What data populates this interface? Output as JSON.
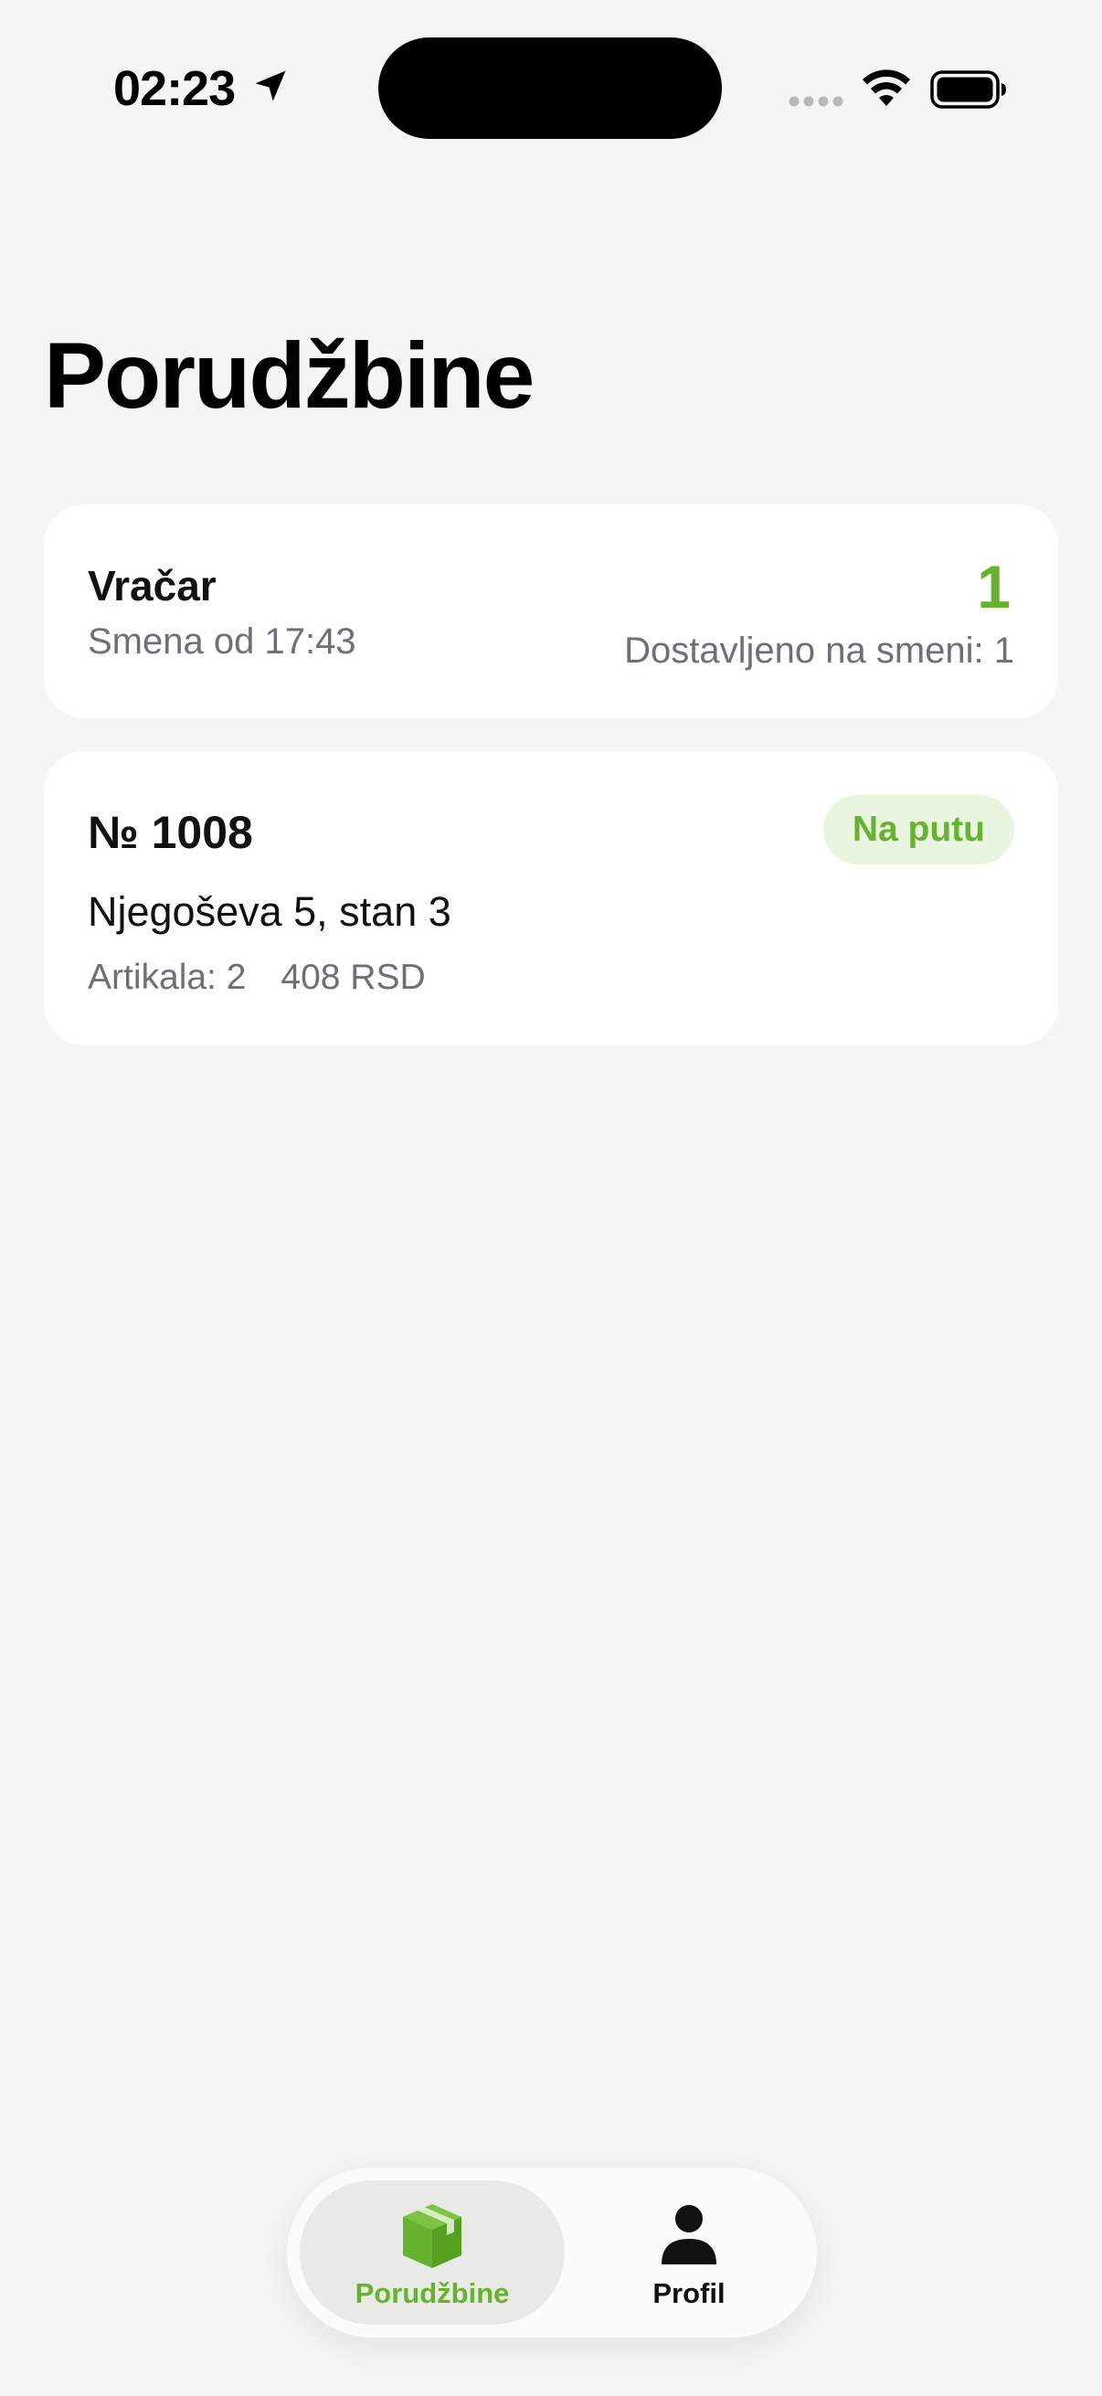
{
  "status_bar": {
    "time": "02:23",
    "icons": [
      "location-arrow-icon",
      "cellular-signal-icon",
      "wifi-icon",
      "battery-icon"
    ]
  },
  "page": {
    "title": "Porudžbine"
  },
  "shift_card": {
    "area": "Vračar",
    "shift_start": "Smena od 17:43",
    "delivered_count": "1",
    "delivered_label": "Dostavljeno na smeni: 1"
  },
  "orders": [
    {
      "number": "№ 1008",
      "status": "Na putu",
      "address": "Njegoševa 5, stan 3",
      "items": "Artikala: 2",
      "total": "408 RSD"
    }
  ],
  "tab_bar": {
    "tabs": [
      {
        "label": "Porudžbine",
        "icon": "package-box-icon",
        "active": true
      },
      {
        "label": "Profil",
        "icon": "person-icon",
        "active": false
      }
    ]
  },
  "colors": {
    "background": "#f5f5f3",
    "card": "#ffffff",
    "accent_green": "#65b32e",
    "badge_background": "#eaf5df",
    "secondary_text": "#6f6f75",
    "active_tab_background": "#e9e9e5"
  }
}
